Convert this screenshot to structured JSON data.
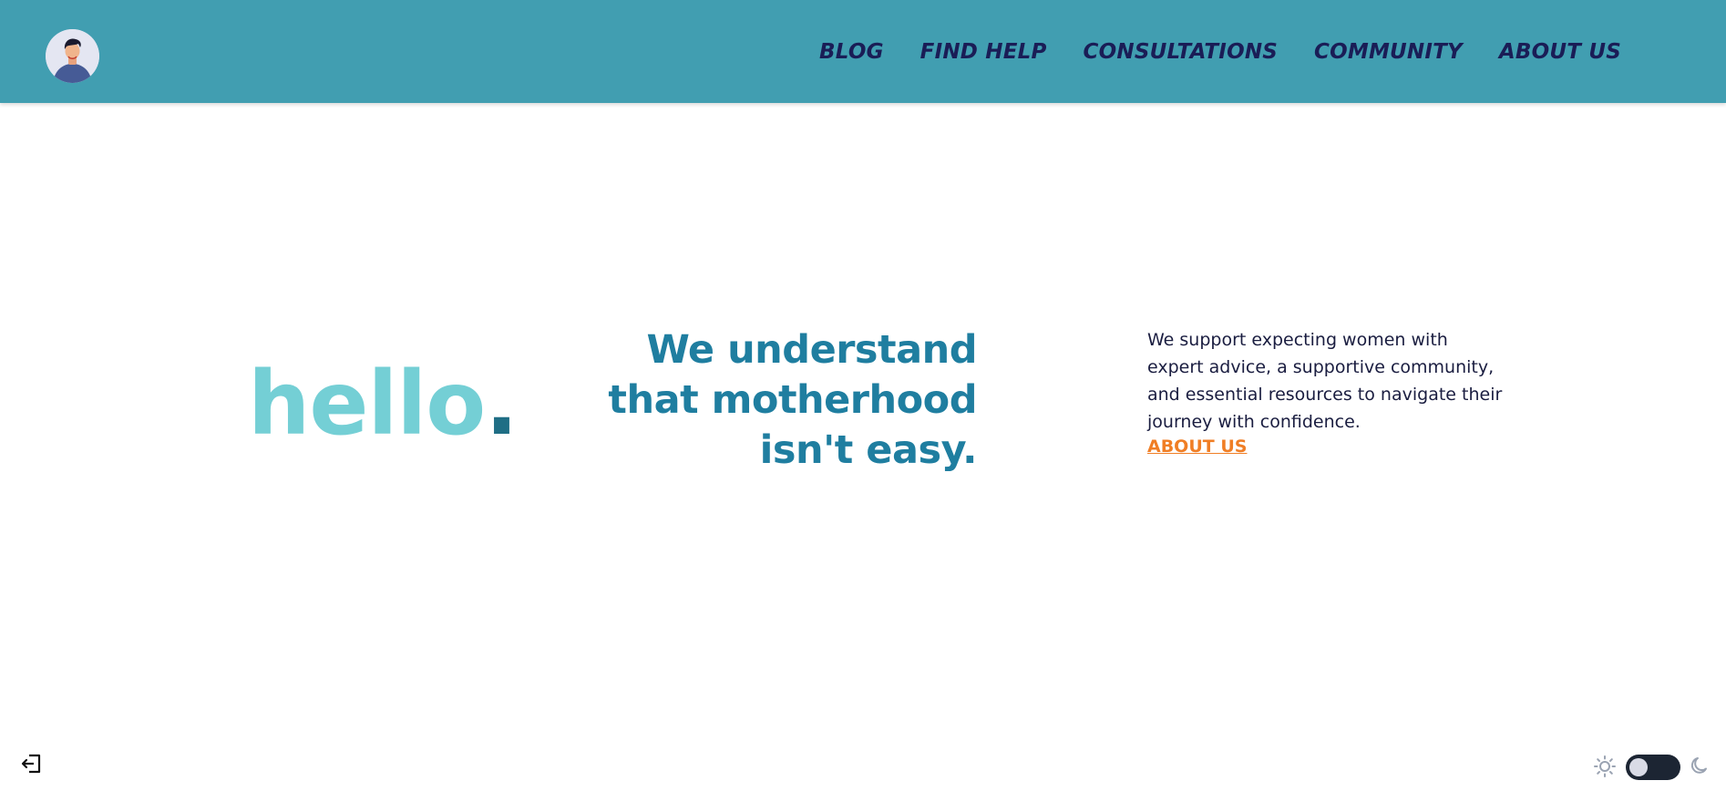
{
  "nav": {
    "items": [
      {
        "label": "BLOG"
      },
      {
        "label": "FIND HELP"
      },
      {
        "label": "CONSULTATIONS"
      },
      {
        "label": "COMMUNITY"
      },
      {
        "label": "ABOUT US"
      }
    ]
  },
  "hero": {
    "hello_word": "hello",
    "hello_dot": ".",
    "headline_lines": [
      "We understand",
      "that motherhood",
      "isn't easy."
    ],
    "blurb_lines": [
      "We support expecting women with",
      "expert advice, a supportive community,",
      "and essential resources to navigate their",
      "journey with confidence."
    ],
    "about_link": "ABOUT US"
  },
  "icons": {
    "avatar": "user-avatar",
    "logout": "logout-icon",
    "sun": "sun-icon",
    "moon": "moon-icon"
  },
  "theme": {
    "dark_mode_enabled": false
  },
  "colors": {
    "navbar": "#419eb1",
    "nav_text": "#1a1d56",
    "hello": "#74cfd5",
    "hello_dot": "#1f6e85",
    "headline": "#1f7ea0",
    "link": "#f07e25"
  }
}
